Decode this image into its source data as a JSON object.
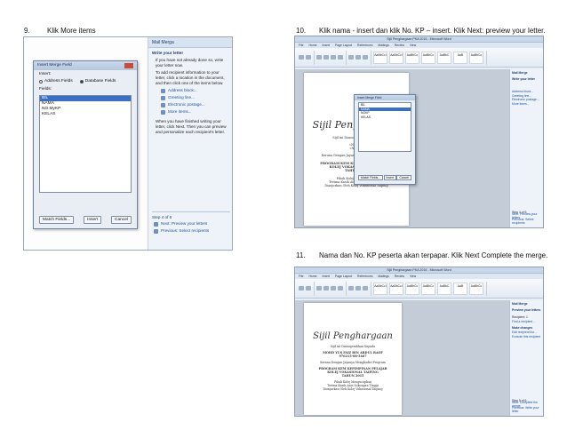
{
  "steps": {
    "s9": {
      "num": "9.",
      "text": "Klik More items"
    },
    "s10": {
      "num": "10.",
      "text": "Klik nama - insert dan klik No. KP – insert. Klik Next: preview your letter."
    },
    "s11": {
      "num": "11.",
      "text": "Nama dan No. KP peserta akan terpapar. Klik Next Complete the merge."
    }
  },
  "shot9": {
    "pane_title": "Mail Merga",
    "pane_section": "Write your letter",
    "pane_intro": "If you have not already done so, write your letter now.",
    "pane_add_info": "To add recipient information to your letter, click a location in the document, and then click one of the items below.",
    "links": [
      "Address block...",
      "Greeting line...",
      "Electronic postage...",
      "More items..."
    ],
    "pane_after": "When you have finished writing your letter, click Next. Then you can preview and personalize each recipient's letter.",
    "step_label": "Step 4 of 6",
    "next_label": "Next: Preview your letters",
    "prev_label": "Previous: Select recipients",
    "dialog": {
      "title": "Insert Merge Field",
      "insert_label": "Insert:",
      "opt_address": "Address Fields",
      "opt_database": "Database Fields",
      "fields_label": "Fields:",
      "fields": [
        "BIL",
        "NAMA",
        "NO.MyKP",
        "KELAS"
      ],
      "match_button": "Match Fields...",
      "insert_button": "Insert",
      "cancel_button": "Cancel"
    }
  },
  "shot10": {
    "window_title": "Sijil Penghargaan PKA 2015 - Microsoft Word",
    "tabs": [
      "File",
      "Home",
      "Insert",
      "Page Layout",
      "References",
      "Mailings",
      "Review",
      "View"
    ],
    "styles": [
      "AaBbCcI",
      "AaBbCcI",
      "AaBbCc",
      "AaBbCc",
      "AaBbC",
      "AaB",
      "AaBbCc"
    ],
    "cert": {
      "title": "Sijil Penghargaan",
      "l1": "Sijil ini Dianugerahkan Kepada",
      "merge_name": "«NAMA»",
      "merge_kp": "«NOKP»",
      "l2": "Kerana Dengan Jayanya Menghadiri Program",
      "prog1": "PROGRAM KEM KEPIMPINAN PELAJAR",
      "prog2": "KOLEJ VOKASIONAL TAIPING",
      "prog3": "TAHUN 2015",
      "l3": "Pihak Kolej Mengucapkan",
      "l4": "Terima Kasih Atas Sokongan Tinggi",
      "l5": "Dianjurkan Oleh Kolej Vokasional Taiping"
    },
    "dialog": {
      "title": "Insert Merge Field",
      "fields": [
        "BIL",
        "NAMA",
        "NOKP",
        "KELAS"
      ],
      "match_button": "Match Fields...",
      "insert_button": "Insert",
      "cancel_button": "Cancel"
    },
    "side_title": "Mail Merge",
    "side_section": "Write your letter",
    "side_links": [
      "Address block...",
      "Greeting line...",
      "Electronic postage...",
      "More items..."
    ],
    "side_step": "Step 4 of 6",
    "side_next": "Next: Preview your letters",
    "side_prev": "Previous: Select recipients"
  },
  "shot11": {
    "window_title": "Sijil Penghargaan PKA 2015 - Microsoft Word",
    "tabs": [
      "File",
      "Home",
      "Insert",
      "Page Layout",
      "References",
      "Mailings",
      "Review",
      "View"
    ],
    "styles": [
      "AaBbCcI",
      "AaBbCcI",
      "AaBbCc",
      "AaBbCc",
      "AaBbC",
      "AaB",
      "AaBbCc"
    ],
    "cert": {
      "title": "Sijil Penghargaan",
      "l1": "Sijil ini Dianugerahkan Kepada",
      "name": "MOHD YUS FAIZ BIN ABDUL RAOF",
      "kp": "970215-08-5467",
      "l2": "Kerana Dengan Jayanya Menghadiri Program",
      "prog1": "PROGRAM KEM KEPIMPINAN PELAJAR",
      "prog2": "KOLEJ VOKASIONAL TAIPING",
      "prog3": "TAHUN 2015",
      "l3": "Pihak Kolej Mengucapkan",
      "l4": "Terima Kasih Atas Sokongan Tinggi",
      "l5": "Dianjurkan Oleh Kolej Vokasional Taiping"
    },
    "side_title": "Mail Merge",
    "side_section": "Preview your letters",
    "side_recipient": "Recipient: 1",
    "side_find": "Find a recipient...",
    "side_changes": "Make changes",
    "side_edit": "Edit recipient list...",
    "side_exclude": "Exclude this recipient",
    "side_step": "Step 5 of 6",
    "side_next": "Next: Complete the merge",
    "side_prev": "Previous: Write your letter"
  }
}
